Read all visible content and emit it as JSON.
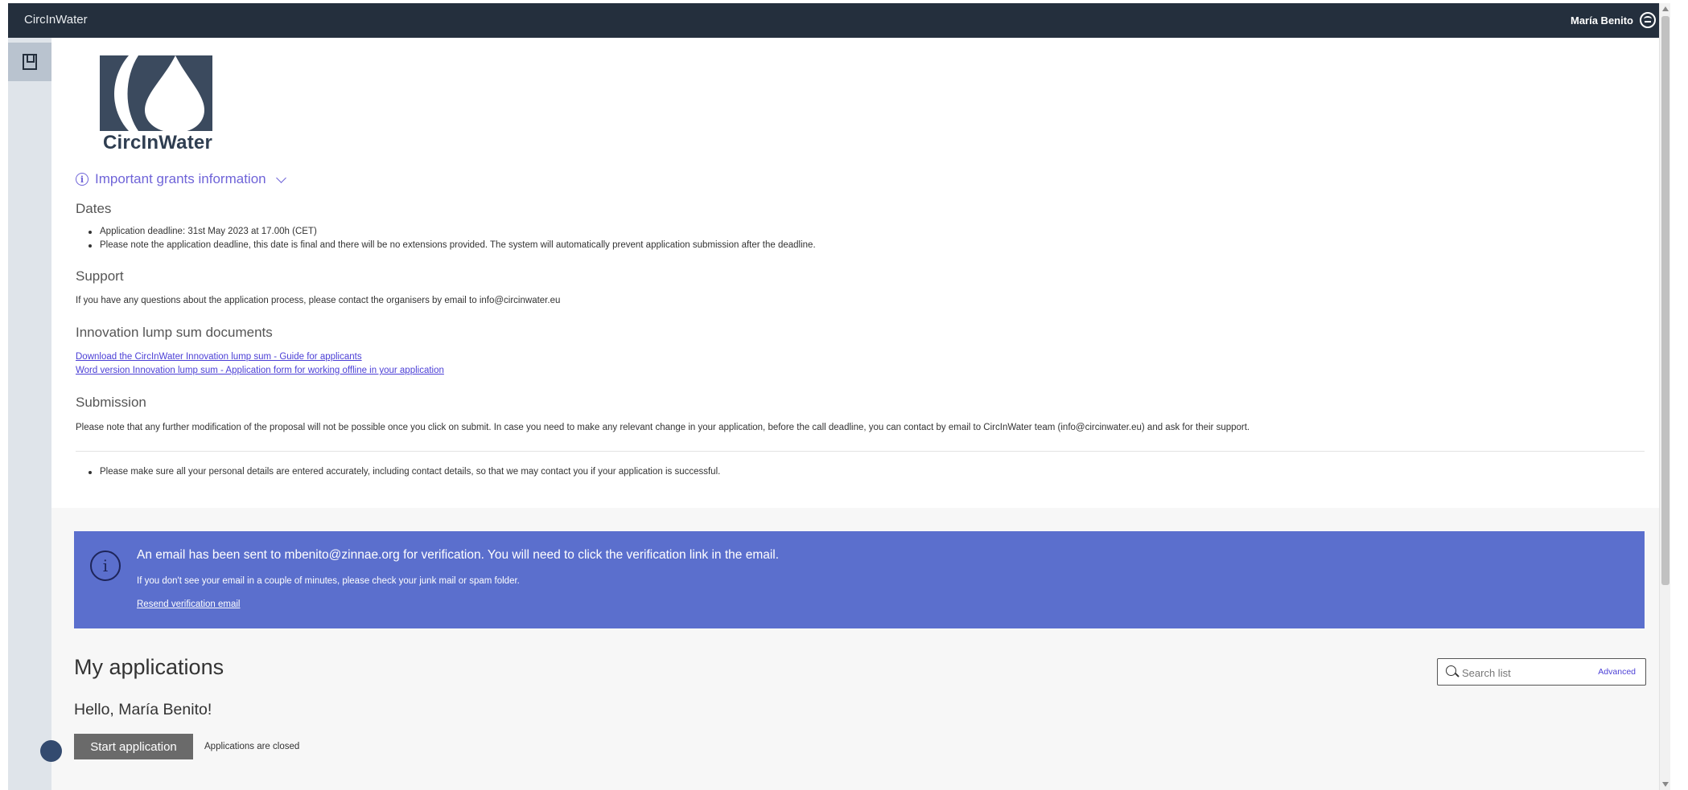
{
  "topbar": {
    "app_name": "CircInWater",
    "user_name": "María Benito"
  },
  "logo": {
    "text": "CircInWater"
  },
  "grants_info": {
    "toggle_label": "Important grants information",
    "dates": {
      "title": "Dates",
      "items": [
        "Application deadline: 31st May 2023 at 17.00h (CET)",
        "Please note the application deadline, this date is final and there will be no extensions provided. The system will automatically prevent application submission after the deadline."
      ]
    },
    "support": {
      "title": "Support",
      "text": "If you have any questions about the application process, please contact the organisers by email to info@circinwater.eu"
    },
    "documents": {
      "title": "Innovation lump sum documents",
      "links": [
        "Download the CircInWater Innovation lump sum - Guide for applicants",
        "Word version Innovation lump sum - Application form for working offline in your application"
      ]
    },
    "submission": {
      "title": "Submission",
      "text": "Please note that any further modification of the proposal will not be possible once you click on submit. In case you need to make any relevant change in your application, before the call deadline, you can contact by email to CircInWater team (info@circinwater.eu) and ask for their support.",
      "note": "Please make sure all your personal details are entered accurately, including contact details, so that we may contact you if your application is successful."
    }
  },
  "verification_banner": {
    "message": "An email has been sent to mbenito@zinnae.org for verification. You will need to click the verification link in the email.",
    "sub": "If you don't see your email in a couple of minutes, please check your junk mail or spam folder.",
    "resend_label": "Resend verification email",
    "color": "#5b6fcd"
  },
  "applications": {
    "title": "My applications",
    "greeting": "Hello, María Benito!",
    "start_label": "Start application",
    "status_note": "Applications are closed",
    "search_placeholder": "Search list",
    "advanced_label": "Advanced"
  }
}
